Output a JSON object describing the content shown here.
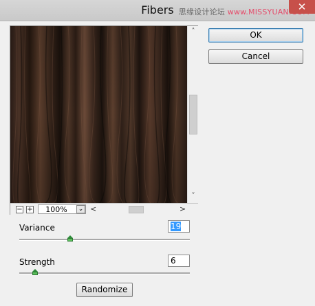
{
  "window": {
    "title": "Fibers",
    "watermark": "思缘设计论坛",
    "watermark_brand": "www.MISSYUAN.COM",
    "close_glyph": "✕"
  },
  "preview": {
    "zoom_value": "100%",
    "zoom_out": "−",
    "zoom_in": "+",
    "scroll_up": "˄",
    "scroll_down": "˅",
    "scroll_left": "<",
    "scroll_right": ">",
    "dropdown_glyph": "⌄"
  },
  "buttons": {
    "ok": "OK",
    "cancel": "Cancel",
    "randomize": "Randomize"
  },
  "controls": {
    "variance": {
      "label": "Variance",
      "value": "19",
      "slider_fraction": 0.29
    },
    "strength": {
      "label": "Strength",
      "value": "6",
      "slider_fraction": 0.08
    }
  },
  "colors": {
    "accent": "#3399ff",
    "fiber_dark": "#1a1210",
    "fiber_light": "#6b4a38"
  }
}
